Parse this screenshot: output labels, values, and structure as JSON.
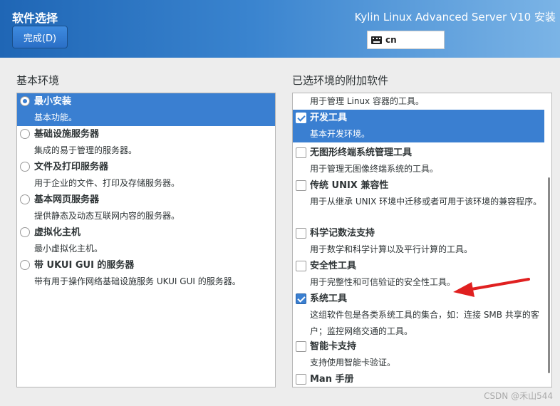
{
  "header": {
    "title": "软件选择",
    "done_label": "完成(D)",
    "product": "Kylin Linux Advanced Server V10 安装",
    "keyboard_layout": "cn"
  },
  "base_env": {
    "heading": "基本环境",
    "items": [
      {
        "title": "最小安装",
        "desc": "基本功能。",
        "selected": true
      },
      {
        "title": "基础设施服务器",
        "desc": "集成的易于管理的服务器。",
        "selected": false
      },
      {
        "title": "文件及打印服务器",
        "desc": "用于企业的文件、打印及存储服务器。",
        "selected": false
      },
      {
        "title": "基本网页服务器",
        "desc": "提供静态及动态互联网内容的服务器。",
        "selected": false
      },
      {
        "title": "虚拟化主机",
        "desc": "最小虚拟化主机。",
        "selected": false
      },
      {
        "title": "带 UKUI GUI 的服务器",
        "desc": "带有用于操作网络基础设施服务 UKUI GUI 的服务器。",
        "selected": false
      }
    ]
  },
  "addons": {
    "heading": "已选环境的附加软件",
    "partial_desc": "用于管理 Linux 容器的工具。",
    "items": [
      {
        "title": "开发工具",
        "desc": "基本开发环境。",
        "checked": true,
        "highlighted": true
      },
      {
        "title": "无图形终端系统管理工具",
        "desc": "用于管理无图像终端系统的工具。",
        "checked": false
      },
      {
        "title": "传统 UNIX 兼容性",
        "desc": "用于从继承 UNIX 环境中迁移或者可用于该环境的兼容程序。",
        "checked": false
      },
      {
        "title": "科学记数法支持",
        "desc": "用于数学和科学计算以及平行计算的工具。",
        "checked": false
      },
      {
        "title": "安全性工具",
        "desc": "用于完整性和可信验证的安全性工具。",
        "checked": false
      },
      {
        "title": "系统工具",
        "desc": "这组软件包是各类系统工具的集合，如：连接 SMB 共享的客户；监控网络交通的工具。",
        "checked": true
      },
      {
        "title": "智能卡支持",
        "desc": "支持使用智能卡验证。",
        "checked": false
      },
      {
        "title": "Man 手册",
        "desc": "",
        "checked": false
      }
    ]
  },
  "watermark": "CSDN @禾山544",
  "colors": {
    "accent": "#3a7fd1",
    "arrow": "#e02020"
  }
}
